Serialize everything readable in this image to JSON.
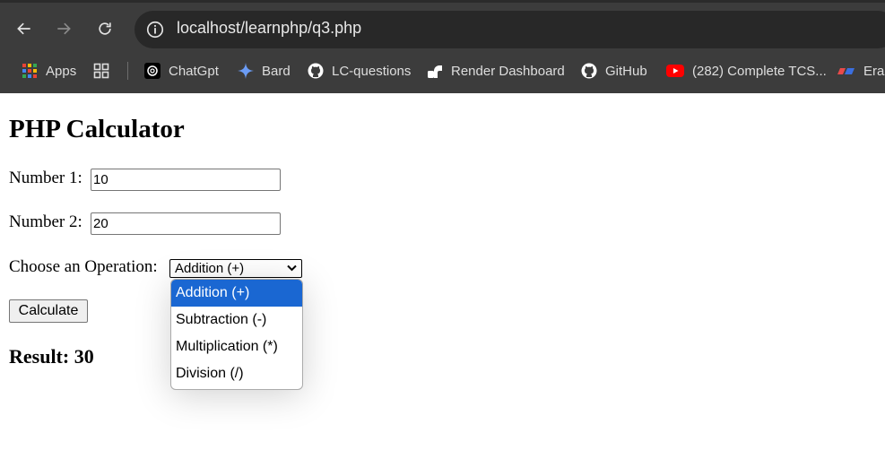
{
  "browser": {
    "url": "localhost/learnphp/q3.php",
    "bookmarks": [
      {
        "label": "Apps",
        "icon": "apps-grid-icon"
      },
      {
        "label": "ChatGpt",
        "icon": "chatgpt-icon"
      },
      {
        "label": "Bard",
        "icon": "bard-sparkle-icon"
      },
      {
        "label": "LC-questions",
        "icon": "github-icon"
      },
      {
        "label": "Render Dashboard",
        "icon": "render-icon"
      },
      {
        "label": "GitHub",
        "icon": "github-icon"
      },
      {
        "label": "(282) Complete TCS...",
        "icon": "youtube-icon"
      },
      {
        "label": "Eras",
        "icon": "eraser-icon"
      }
    ]
  },
  "page": {
    "title": "PHP Calculator",
    "number1_label": "Number 1:",
    "number1_value": "10",
    "number2_label": "Number 2:",
    "number2_value": "20",
    "operation_label": "Choose an Operation:",
    "operation_selected": "Addition (+)",
    "operation_options": [
      "Addition (+)",
      "Subtraction (-)",
      "Multiplication (*)",
      "Division (/)"
    ],
    "calculate_label": "Calculate",
    "result_text": "Result: 30"
  },
  "colors": {
    "toolbar_bg": "#3c3c3c",
    "omnibox_bg": "#282828",
    "selected_option_bg": "#1a67d2"
  }
}
